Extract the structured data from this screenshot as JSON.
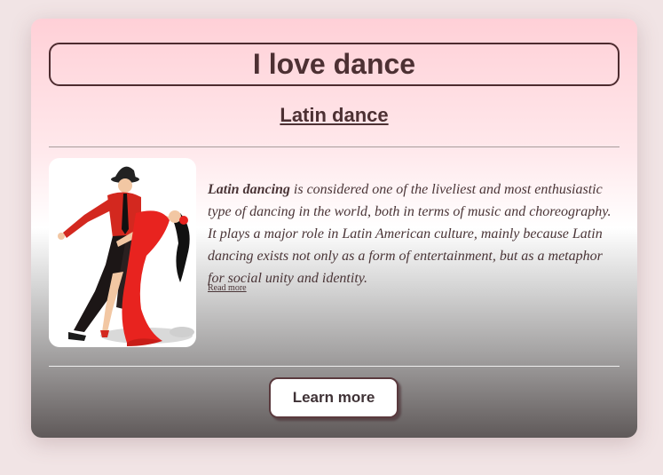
{
  "card": {
    "title": "I love dance",
    "subtitle": "Latin dance",
    "image": {
      "icon": "latin-dancers-illustration"
    },
    "description": {
      "lead": "Latin dancing",
      "body": " is considered one of the liveliest and most enthusiastic type of dancing in the world, both in terms of music and choreography. It plays a major role in Latin American culture, mainly because Latin dancing exists not only as a form of entertainment, but as a metaphor for social unity and identity."
    },
    "read_more": "Read more",
    "learn_more": "Learn more"
  },
  "colors": {
    "text": "#4d3033",
    "gradient_top": "#ffd0d7",
    "gradient_bottom": "#5f5959",
    "dress": "#e8231f"
  }
}
